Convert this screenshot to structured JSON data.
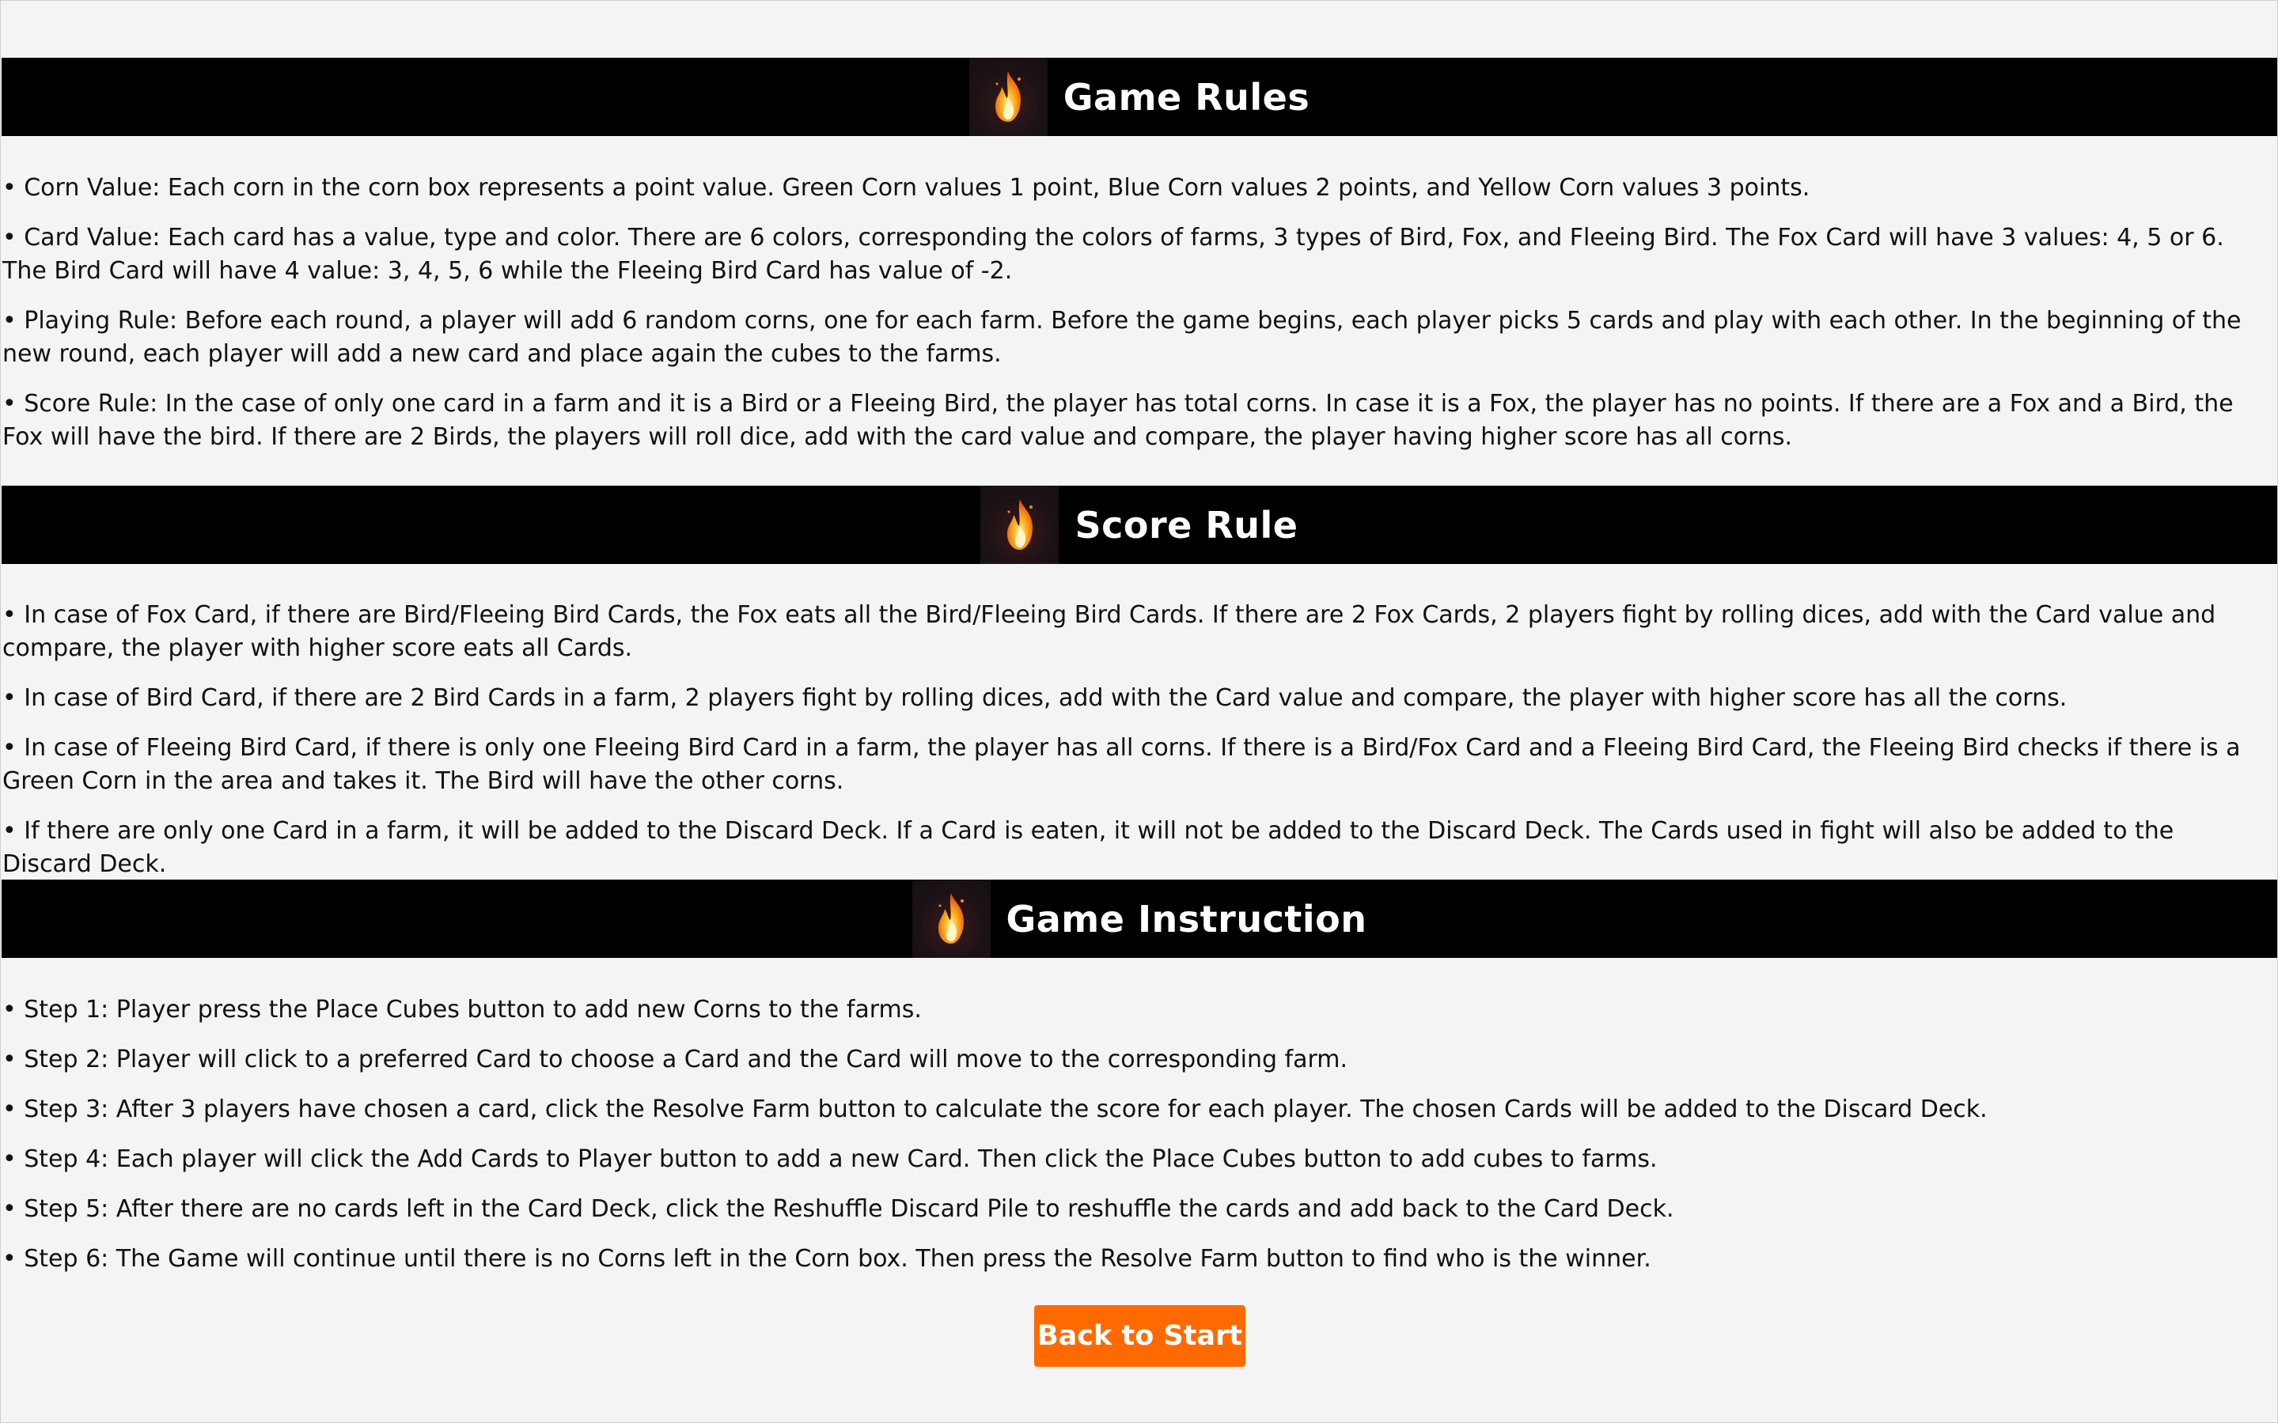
{
  "sections": [
    {
      "title": "Game Rules",
      "icon": "flame-icon",
      "items": [
        "• Corn Value: Each corn in the corn box represents a point value. Green Corn values 1 point, Blue Corn values 2 points, and Yellow Corn values 3 points.",
        "• Card Value: Each card has a value, type and color. There are 6 colors, corresponding the colors of farms, 3 types of Bird, Fox, and Fleeing Bird. The Fox Card will have 3 values: 4, 5 or 6. The Bird Card will have 4 value: 3, 4, 5, 6 while the Fleeing Bird Card has value of -2.",
        "• Playing Rule: Before each round, a player will add 6 random corns, one for each farm. Before the game begins, each player picks 5 cards and play with each other. In the beginning of the new round, each player will add a new card and place again the cubes to the farms.",
        "• Score Rule: In the case of only one card in a farm and it is a Bird or a Fleeing Bird, the player has total corns. In case it is a Fox, the player has no points. If there are a Fox and a Bird, the Fox will have the bird. If there are 2 Birds, the players will roll dice, add with the card value and compare, the player having higher score has all corns."
      ]
    },
    {
      "title": "Score Rule",
      "icon": "flame-icon",
      "items": [
        "• In case of Fox Card, if there are Bird/Fleeing Bird Cards, the Fox eats all the Bird/Fleeing Bird Cards. If there are 2 Fox Cards, 2 players fight by rolling dices, add with the Card value and compare, the player with higher score eats all Cards.",
        "• In case of Bird Card, if there are 2 Bird Cards in a farm, 2 players fight by rolling dices, add with the Card value and compare, the player with higher score has all the corns.",
        "• In case of Fleeing Bird Card, if there is only one Fleeing Bird Card in a farm, the player has all corns. If there is a Bird/Fox Card and a Fleeing Bird Card, the Fleeing Bird checks if there is a Green Corn in the area and takes it. The Bird will have the other corns.",
        "• If there are only one Card in a farm, it will be added to the Discard Deck. If a Card is eaten, it will not be added to the Discard Deck. The Cards used in fight will also be added to the Discard Deck."
      ]
    },
    {
      "title": "Game Instruction",
      "icon": "flame-icon",
      "items": [
        "• Step 1: Player press the Place Cubes button to add new Corns to the farms.",
        "• Step 2: Player will click to a preferred Card to choose a Card and the Card will move to the corresponding farm.",
        "• Step 3: After 3 players have chosen a card, click the Resolve Farm button to calculate the score for each player. The chosen Cards will be added to the Discard Deck.",
        "• Step 4: Each player will click the Add Cards to Player button to add a new Card. Then click the Place Cubes button to add cubes to farms.",
        "• Step 5: After there are no cards left in the Card Deck, click the Reshuffle Discard Pile to reshuffle the cards and add back to the Card Deck.",
        "• Step 6: The Game will continue until there is no Corns left in the Corn box. Then press the Resolve Farm button to find who is the winner."
      ]
    }
  ],
  "back_button": {
    "label": "Back to Start"
  },
  "colors": {
    "page_background": "#f4f4f4",
    "header_background": "#000000",
    "header_text": "#ffffff",
    "button_background": "#ff6a00",
    "button_text": "#ffffff"
  }
}
